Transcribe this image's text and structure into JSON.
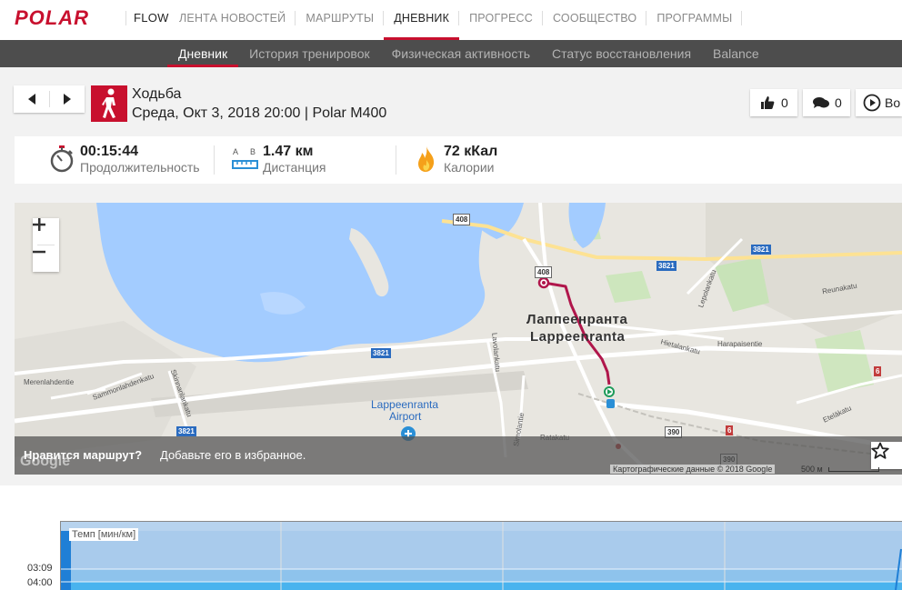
{
  "nav": {
    "brand": "POLAR",
    "flow": "FLOW",
    "items": [
      {
        "label": "ЛЕНТА НОВОСТЕЙ"
      },
      {
        "label": "МАРШРУТЫ"
      },
      {
        "label": "ДНЕВНИК"
      },
      {
        "label": "ПРОГРЕСС"
      },
      {
        "label": "СООБЩЕСТВО"
      },
      {
        "label": "ПРОГРАММЫ"
      }
    ],
    "active_index": 2
  },
  "subnav": {
    "items": [
      {
        "label": "Дневник"
      },
      {
        "label": "История тренировок"
      },
      {
        "label": "Физическая активность"
      },
      {
        "label": "Статус восстановления"
      },
      {
        "label": "Balance"
      }
    ],
    "active_index": 0
  },
  "session": {
    "sport": "Ходьба",
    "info": "Среда, Окт 3, 2018 20:00 | Polar M400",
    "likes": "0",
    "comments": "0",
    "play_label": "Во"
  },
  "stats": {
    "duration": {
      "value": "00:15:44",
      "label": "Продолжительность"
    },
    "distance": {
      "value": "1.47 км",
      "label": "Дистанция",
      "icon_a": "A",
      "icon_b": "B"
    },
    "calories": {
      "value": "72 кКал",
      "label": "Калории"
    }
  },
  "map": {
    "city_ru": "Лаппеенранта",
    "city_en": "Lappeenranta",
    "airport_line1": "Lappeenranta",
    "airport_line2": "Airport",
    "streets": {
      "merenlahdentie": "Merenlahdentie",
      "sammonlahdenkatu": "Sammonlahdenkatu",
      "skinnarilankatu": "Skinnarilankatu",
      "lavolankatu": "Lavolankatu",
      "simolantie": "Simolantie",
      "ratakatu": "Ratakatu",
      "hietalankatu": "Hietalankatu",
      "harapaisentie": "Harapaisentie",
      "lepolankatu": "Lepolankatu",
      "reunakatu": "Reunakatu",
      "etelakatu": "Eteläkatu"
    },
    "roads": {
      "r408a": "408",
      "r408b": "408",
      "r3821a": "3821",
      "r3821b": "3821",
      "r3821c": "3821",
      "r3821d": "3821",
      "r390a": "390",
      "r390b": "390",
      "r6a": "6",
      "r6b": "6"
    },
    "google": "Google",
    "attribution": "Картографические данные © 2018 Google",
    "scale": "500 м",
    "fav_question": "Нравится маршрут?",
    "fav_text": "Добавьте его в избранное."
  },
  "chart": {
    "label": "Темп [мин/км]",
    "yticks": [
      "03:09",
      "04:00"
    ]
  },
  "colors": {
    "accent": "#c8102e",
    "subnav_bg": "#4d4d4d",
    "route": "#b0164b",
    "water": "#a3ccff"
  }
}
